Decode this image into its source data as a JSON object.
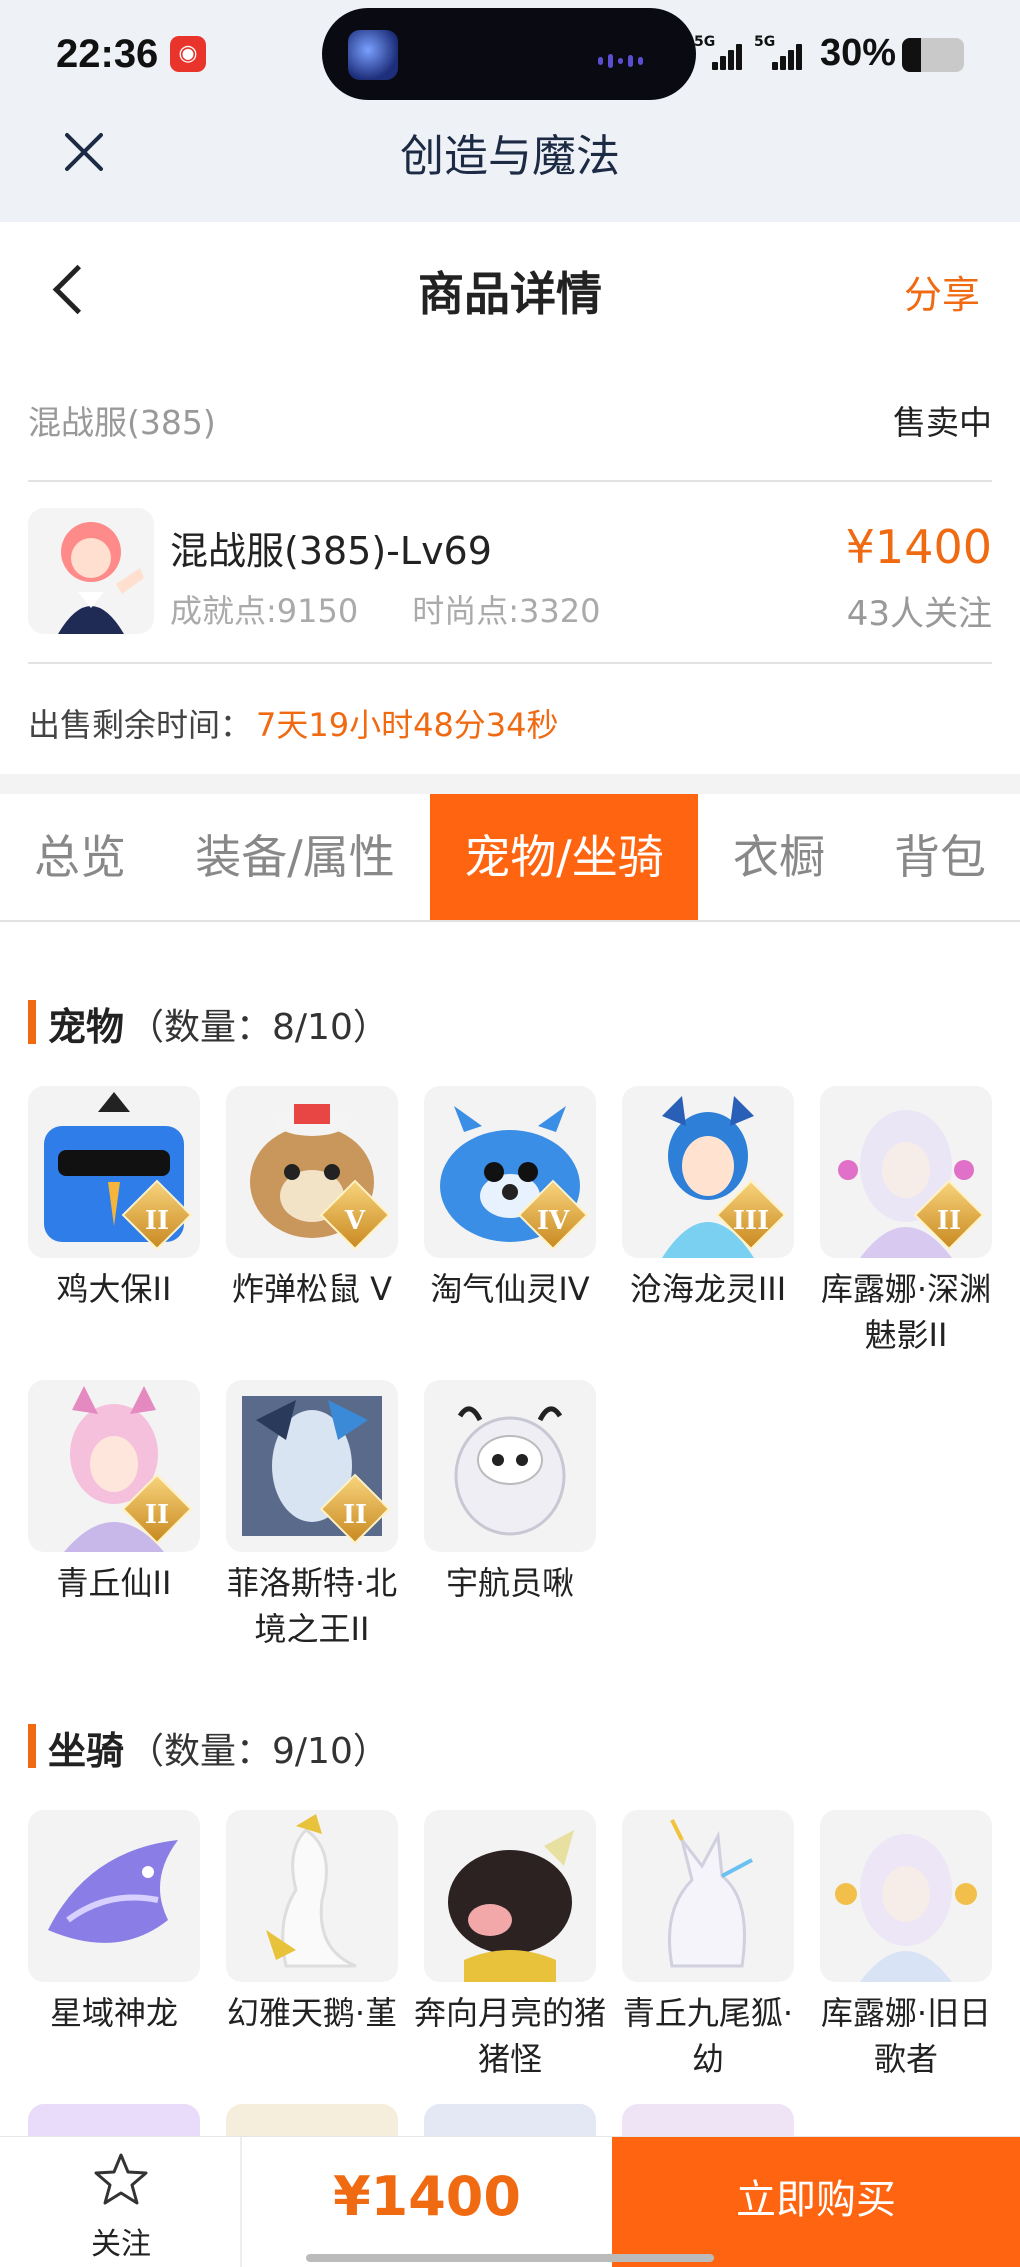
{
  "status_bar": {
    "time": "22:36",
    "notification_app": "netease-cloud-music-icon",
    "signal_1_label": "5G",
    "signal_2_label": "5G",
    "battery_percent": "30%",
    "battery_level": 0.3
  },
  "app_header": {
    "title": "创造与魔法"
  },
  "page_header": {
    "title": "商品详情",
    "share": "分享"
  },
  "server": {
    "name": "混战服(385)",
    "status": "售卖中"
  },
  "character": {
    "name": "混战服(385)-Lv69",
    "achievement": "成就点:9150",
    "fashion": "时尚点:3320",
    "price": "¥1400",
    "followers": "43人关注"
  },
  "sale_time": {
    "label": "出售剩余时间：",
    "value": "7天19小时48分34秒"
  },
  "tabs": [
    "总览",
    "装备/属性",
    "宠物/坐骑",
    "衣橱",
    "背包"
  ],
  "active_tab": 2,
  "pets": {
    "title": "宠物",
    "count": "（数量：8/10）",
    "items": [
      {
        "name": "鸡大保II",
        "tier": "II",
        "color": "#2f7de8"
      },
      {
        "name": "炸弹松鼠 V",
        "tier": "V",
        "color": "#b07a45"
      },
      {
        "name": "淘气仙灵IV",
        "tier": "IV",
        "color": "#3b8ee6"
      },
      {
        "name": "沧海龙灵III",
        "tier": "III",
        "color": "#4a9de0"
      },
      {
        "name": "库露娜·深渊魅影II",
        "tier": "II",
        "color": "#d8c9f0"
      },
      {
        "name": "青丘仙II",
        "tier": "II",
        "color": "#f0b8d8"
      },
      {
        "name": "菲洛斯特·北境之王II",
        "tier": "II",
        "color": "#3c5a8e"
      },
      {
        "name": "宇航员啾",
        "tier": "",
        "color": "#e6e6ee"
      }
    ]
  },
  "mounts": {
    "title": "坐骑",
    "count": "（数量：9/10）",
    "items": [
      {
        "name": "星域神龙",
        "color": "#8a7ee6"
      },
      {
        "name": "幻雅天鹅·堇",
        "color": "#f2f2f6"
      },
      {
        "name": "奔向月亮的猪猪怪",
        "color": "#3a2a2a"
      },
      {
        "name": "青丘九尾狐·幼",
        "color": "#e9e9f2"
      },
      {
        "name": "库露娜·旧日歌者",
        "color": "#e3dcf2"
      }
    ]
  },
  "bottom_bar": {
    "follow_label": "关注",
    "price": "¥1400",
    "buy_label": "立即购买"
  },
  "colors": {
    "accent": "#ff6410",
    "price": "#f06a12",
    "header_bg": "#eef2f7"
  }
}
